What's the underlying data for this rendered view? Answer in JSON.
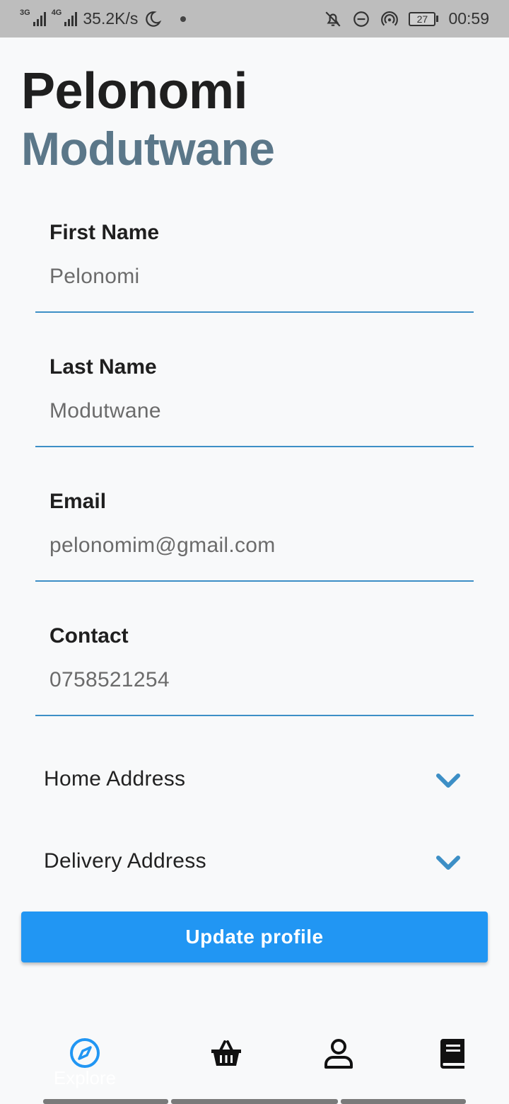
{
  "status_bar": {
    "net1": "3G",
    "net2": "4G",
    "speed": "35.2K/s",
    "battery": "27",
    "time": "00:59"
  },
  "header": {
    "first": "Pelonomi",
    "last": "Modutwane",
    "first_color": "#1f1f1f",
    "last_color": "#5b7789"
  },
  "form": {
    "first_name": {
      "label": "First Name",
      "value": "Pelonomi"
    },
    "last_name": {
      "label": "Last Name",
      "value": "Modutwane"
    },
    "email": {
      "label": "Email",
      "value": "pelonomim@gmail.com"
    },
    "contact": {
      "label": "Contact",
      "value": "0758521254"
    }
  },
  "addresses": {
    "home": "Home Address",
    "delivery": "Delivery Address"
  },
  "actions": {
    "update": "Update profile"
  },
  "bottom_nav": {
    "explore": "Explore",
    "items": [
      "compass-icon",
      "basket-icon",
      "profile-icon",
      "book-icon"
    ],
    "accent": "#2196f3"
  }
}
